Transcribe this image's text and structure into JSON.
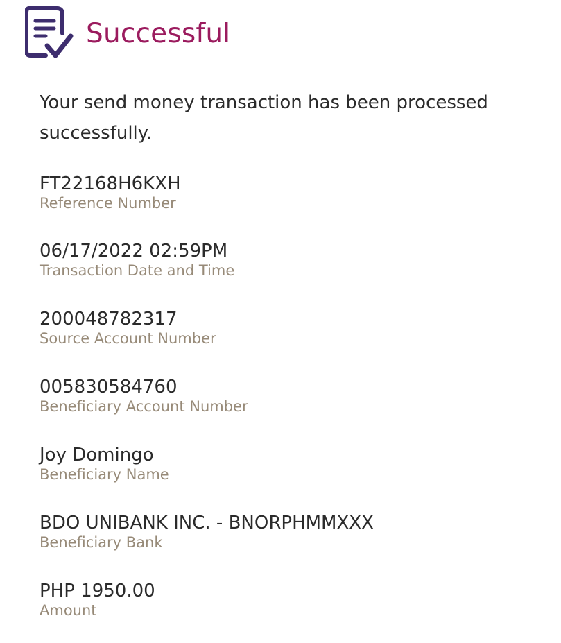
{
  "header": {
    "icon": "document-check-icon",
    "title": "Successful",
    "title_color": "#9b1b5e",
    "icon_color": "#3d2d6e"
  },
  "message": "Your send money transaction has been processed successfully.",
  "details": [
    {
      "value": "FT22168H6KXH",
      "label": "Reference Number"
    },
    {
      "value": "06/17/2022 02:59PM",
      "label": "Transaction Date and Time"
    },
    {
      "value": "200048782317",
      "label": "Source Account Number"
    },
    {
      "value": "005830584760",
      "label": "Beneficiary Account Number"
    },
    {
      "value": "Joy Domingo",
      "label": "Beneficiary Name"
    },
    {
      "value": "BDO UNIBANK INC. - BNORPHMMXXX",
      "label": "Beneficiary Bank"
    },
    {
      "value": "PHP 1950.00",
      "label": "Amount"
    }
  ]
}
